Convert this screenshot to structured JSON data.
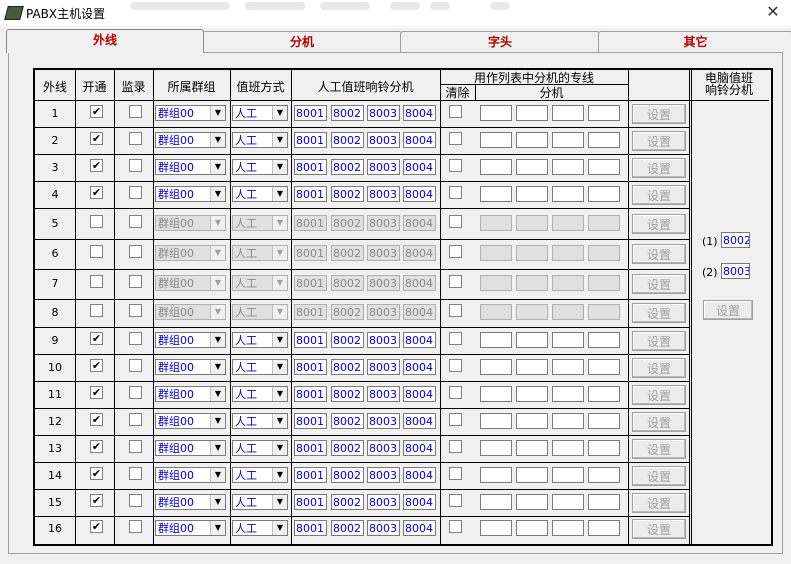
{
  "window": {
    "title": "PABX主机设置",
    "close_glyph": "✕"
  },
  "tabs": [
    {
      "label": "外线",
      "active": true
    },
    {
      "label": "分机",
      "active": false
    },
    {
      "label": "字头",
      "active": false
    },
    {
      "label": "其它",
      "active": false
    }
  ],
  "headers": {
    "line": "外线",
    "open": "开通",
    "monitor": "监录",
    "group": "所属群组",
    "duty": "值班方式",
    "ring": "人工值班响铃分机",
    "dedicated_title": "用作列表中分机的专线",
    "clear": "清除",
    "extension": "分机",
    "pc_duty": "电脑值班",
    "pc_duty2": "响铃分机"
  },
  "rows": [
    {
      "num": "1",
      "enabled": true
    },
    {
      "num": "2",
      "enabled": true
    },
    {
      "num": "3",
      "enabled": true
    },
    {
      "num": "4",
      "enabled": true
    },
    {
      "num": "5",
      "enabled": false
    },
    {
      "num": "6",
      "enabled": false
    },
    {
      "num": "7",
      "enabled": false
    },
    {
      "num": "8",
      "enabled": false
    },
    {
      "num": "9",
      "enabled": true
    },
    {
      "num": "10",
      "enabled": true
    },
    {
      "num": "11",
      "enabled": true
    },
    {
      "num": "12",
      "enabled": true
    },
    {
      "num": "13",
      "enabled": true
    },
    {
      "num": "14",
      "enabled": true
    },
    {
      "num": "15",
      "enabled": true
    },
    {
      "num": "16",
      "enabled": true
    }
  ],
  "row_values": {
    "group": "群组00",
    "duty": "人工",
    "ring": [
      "8001",
      "8002",
      "8003",
      "8004"
    ],
    "set_label": "设置",
    "checkmark": "✔"
  },
  "pc_duty": {
    "label1": "(1)",
    "value1": "8002",
    "label2": "(2)",
    "value2": "8003",
    "set_label": "设置"
  }
}
